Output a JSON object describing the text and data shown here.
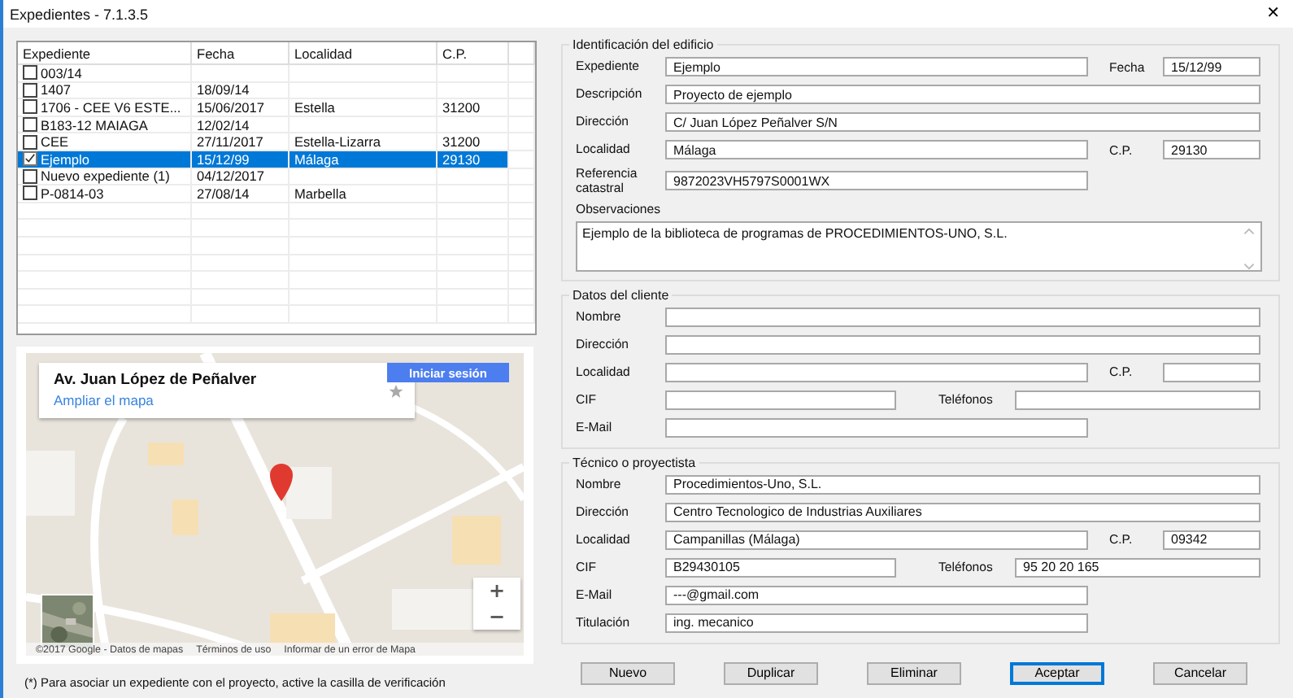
{
  "window": {
    "title": "Expedientes - 7.1.3.5",
    "close": "✕"
  },
  "list": {
    "columns": [
      "Expediente",
      "Fecha",
      "Localidad",
      "C.P."
    ],
    "rows": [
      {
        "checked": false,
        "selected": false,
        "cells": [
          "003/14"
        ]
      },
      {
        "checked": false,
        "selected": false,
        "cells": [
          "1407",
          "18/09/14"
        ]
      },
      {
        "checked": false,
        "selected": false,
        "cells": [
          "1706 - CEE V6 ESTE...",
          "15/06/2017",
          "Estella",
          "31200"
        ]
      },
      {
        "checked": false,
        "selected": false,
        "cells": [
          "B183-12 MAIAGA",
          "12/02/14"
        ]
      },
      {
        "checked": false,
        "selected": false,
        "cells": [
          "CEE",
          "27/11/2017",
          "Estella-Lizarra",
          "31200"
        ]
      },
      {
        "checked": true,
        "selected": true,
        "cells": [
          "Ejemplo",
          "15/12/99",
          "Málaga",
          "29130"
        ]
      },
      {
        "checked": false,
        "selected": false,
        "cells": [
          "Nuevo expediente (1)",
          "04/12/2017"
        ]
      },
      {
        "checked": false,
        "selected": false,
        "cells": [
          "P-0814-03",
          "27/08/14",
          "Marbella"
        ]
      }
    ]
  },
  "map": {
    "kind": "picture",
    "place_title": "Av. Juan López de Peñalver",
    "enlarge_link": "Ampliar el mapa",
    "sign_in": "Iniciar sesión",
    "zoom_in": "+",
    "zoom_out": "−",
    "footer": [
      "©2017 Google - Datos de mapas",
      "Términos de uso",
      "Informar de un error de Mapa"
    ]
  },
  "footnote": "(*) Para asociar un expediente con el proyecto, active la casilla de verificación",
  "sections": [
    {
      "title": "Identificación del edificio",
      "rows": [
        {
          "kind": "pair",
          "label": "Expediente",
          "value": "Ejemplo",
          "label2": "Fecha",
          "value2": "15/12/99"
        },
        {
          "kind": "full",
          "label": "Descripción",
          "value": "Proyecto de ejemplo"
        },
        {
          "kind": "full",
          "label": "Dirección",
          "value": "C/ Juan López Peñalver S/N"
        },
        {
          "kind": "pair",
          "label": "Localidad",
          "value": "Málaga",
          "label2": "C.P.",
          "value2": "29130"
        },
        {
          "kind": "single",
          "label": "Referencia catastral",
          "value": "9872023VH5797S0001WX"
        }
      ],
      "notes": {
        "label": "Observaciones",
        "value": "Ejemplo de la biblioteca de programas de PROCEDIMIENTOS-UNO, S.L."
      }
    },
    {
      "title": "Datos del cliente",
      "rows": [
        {
          "kind": "full",
          "label": "Nombre"
        },
        {
          "kind": "full",
          "label": "Dirección"
        },
        {
          "kind": "pair",
          "label": "Localidad",
          "label2": "C.P."
        },
        {
          "kind": "split",
          "label": "CIF",
          "label2": "Teléfonos"
        },
        {
          "kind": "single",
          "label": "E-Mail"
        }
      ]
    },
    {
      "title": "Técnico o proyectista",
      "rows": [
        {
          "kind": "full",
          "label": "Nombre",
          "value": "Procedimientos-Uno, S.L."
        },
        {
          "kind": "full",
          "label": "Dirección",
          "value": "Centro Tecnologico de Industrias Auxiliares"
        },
        {
          "kind": "pair",
          "label": "Localidad",
          "value": "Campanillas (Málaga)",
          "label2": "C.P.",
          "value2": "09342"
        },
        {
          "kind": "split",
          "label": "CIF",
          "value": "B29430105",
          "label2": "Teléfonos",
          "value2": "95 20 20 165"
        },
        {
          "kind": "single",
          "label": "E-Mail",
          "value": "---@gmail.com"
        },
        {
          "kind": "single",
          "label": "Titulación",
          "value": "ing. mecanico"
        }
      ]
    }
  ],
  "buttons": [
    {
      "label": "Nuevo",
      "default": false
    },
    {
      "label": "Duplicar",
      "default": false
    },
    {
      "label": "Eliminar",
      "default": false
    },
    {
      "label": "Aceptar",
      "default": true
    },
    {
      "label": "Cancelar",
      "default": false
    }
  ]
}
